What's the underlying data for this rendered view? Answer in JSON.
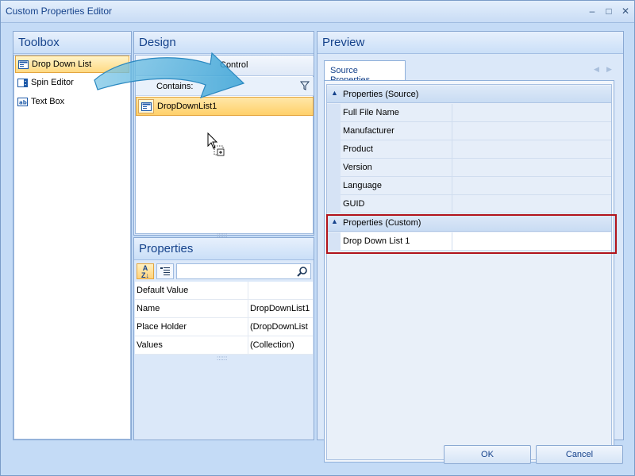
{
  "window": {
    "title": "Custom Properties Editor",
    "controls": [
      "minimize-icon",
      "maximize-icon",
      "close-icon"
    ]
  },
  "toolbox": {
    "title": "Toolbox",
    "items": [
      {
        "label": "Drop Down List",
        "icon": "dropdown-list-icon",
        "selected": true
      },
      {
        "label": "Spin Editor",
        "icon": "spin-editor-icon",
        "selected": false
      },
      {
        "label": "Text Box",
        "icon": "textbox-icon",
        "selected": false
      }
    ]
  },
  "design": {
    "title": "Design",
    "column_header": "Control",
    "filter_label": "Contains:",
    "rows": [
      {
        "label": "DropDownList1",
        "icon": "dropdown-list-icon",
        "selected": true
      }
    ]
  },
  "properties": {
    "title": "Properties",
    "sort_label": "A Z",
    "rows": [
      {
        "name": "Default Value",
        "value": ""
      },
      {
        "name": "Name",
        "value": "DropDownList1"
      },
      {
        "name": "Place Holder",
        "value": "(DropDownList"
      },
      {
        "name": "Values",
        "value": "(Collection)"
      }
    ]
  },
  "preview": {
    "title": "Preview",
    "tab": "Source Properties",
    "categories": [
      {
        "label": "Properties (Source)",
        "rows": [
          "Full File Name",
          "Manufacturer",
          "Product",
          "Version",
          "Language",
          "GUID"
        ]
      },
      {
        "label": "Properties (Custom)",
        "rows": [
          "Drop Down List 1"
        ]
      }
    ]
  },
  "buttons": {
    "ok": "OK",
    "cancel": "Cancel"
  },
  "colors": {
    "accent": "#15428b",
    "highlight": "#b1131b",
    "selection": "#ffd06a"
  }
}
